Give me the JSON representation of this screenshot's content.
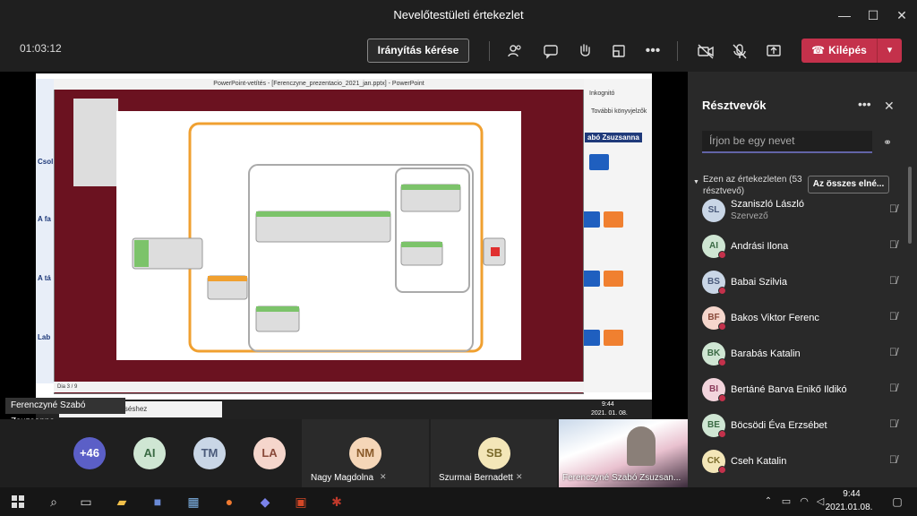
{
  "window": {
    "title": "Nevelőtestületi értekezlet",
    "minimize": "—",
    "maximize": "☐",
    "close": "✕"
  },
  "toolbar": {
    "timer": "01:03:12",
    "control_label": "Irányítás kérése",
    "people_icon": "people-icon",
    "chat_icon": "chat-icon",
    "hand_icon": "raise-hand-icon",
    "rooms_icon": "breakout-rooms-icon",
    "more": "•••",
    "leave_label": "Kilépés"
  },
  "share": {
    "pp_title": "PowerPoint-vetítés - [Ferenczyne_prezentacio_2021_jan.pptx] - PowerPoint",
    "slide_status": "Dia 3 / 9",
    "incognito": "Inkognitó",
    "bookmarks": "További könyvjelzők",
    "name_tag": "abó Zsuzsanna",
    "row_labels": [
      "Csol",
      "A fa",
      "A tá",
      "Lab"
    ],
    "search_placeholder": "Írjon ide a kereséshez",
    "inner_time": "9:44",
    "inner_date": "2021. 01. 08.",
    "presenter": "Ferenczyné Szabó Zsuzsanna"
  },
  "panel": {
    "title": "Résztvevők",
    "more": "•••",
    "close": "✕",
    "search_placeholder": "Írjon be egy nevet",
    "in_meeting": "Ezen az értekezleten (53 résztvevő)",
    "mute_all": "Az összes elné...",
    "participants": [
      {
        "initials": "SL",
        "name": "Szaniszló László",
        "role": "Szervező",
        "color": "#c9d6e6"
      },
      {
        "initials": "AI",
        "name": "Andrási Ilona",
        "role": "",
        "color": "#cfe6d3"
      },
      {
        "initials": "BS",
        "name": "Babai Szilvia",
        "role": "",
        "color": "#c9d6e6"
      },
      {
        "initials": "BF",
        "name": "Bakos Viktor Ferenc",
        "role": "",
        "color": "#f5d6cc"
      },
      {
        "initials": "BK",
        "name": "Barabás Katalin",
        "role": "",
        "color": "#cfe6d3"
      },
      {
        "initials": "BI",
        "name": "Bertáné Barva Enikő Ildikó",
        "role": "",
        "color": "#f2d4dc"
      },
      {
        "initials": "BE",
        "name": "Böcsödi Éva Erzsébet",
        "role": "",
        "color": "#cfe6d3"
      },
      {
        "initials": "CK",
        "name": "Cseh Katalin",
        "role": "",
        "color": "#f3e6b8"
      }
    ]
  },
  "gallery": {
    "more_count": "+46",
    "avatars": [
      {
        "initials": "AI",
        "color": "#cfe6d3"
      },
      {
        "initials": "TM",
        "color": "#c9d6e6"
      },
      {
        "initials": "LA",
        "color": "#f5d6cc"
      }
    ],
    "tiles": [
      {
        "initials": "NM",
        "name": "Nagy Magdolna",
        "color": "#f5d6b8"
      },
      {
        "initials": "SB",
        "name": "Szurmai Bernadett",
        "color": "#f3e6b8"
      }
    ],
    "video_name": "Ferenczyné Szabó Zsuzsan..."
  },
  "taskbar": {
    "time": "9:44",
    "date": "2021.01.08."
  }
}
